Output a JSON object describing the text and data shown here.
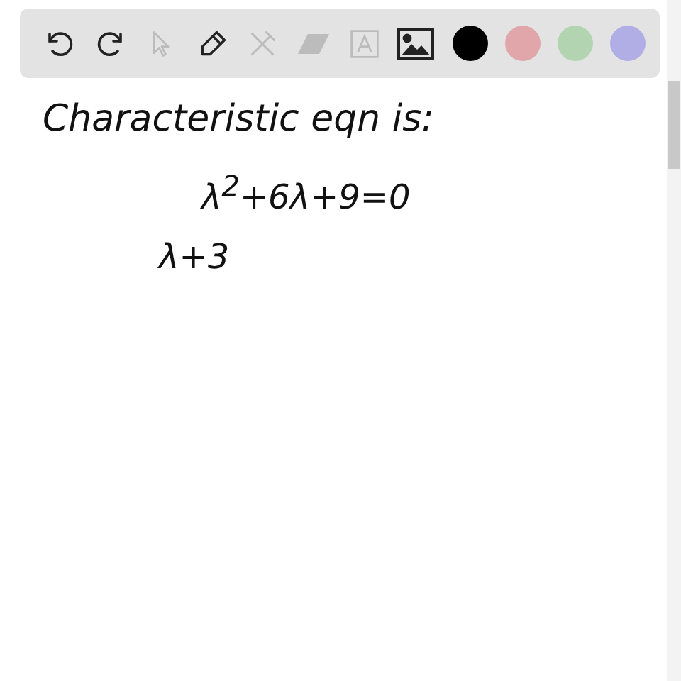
{
  "canvas": {
    "lines": [
      {
        "text": "Characteristic eqn is:",
        "kind": "heading"
      },
      {
        "text": "λ$^{2}$+6λ+9=0",
        "kind": "equation"
      },
      {
        "text": "λ+3",
        "kind": "step"
      }
    ]
  },
  "toolbar": {
    "tools": [
      {
        "kind": "undo",
        "disabled": false
      },
      {
        "kind": "redo",
        "disabled": false
      },
      {
        "kind": "select",
        "disabled": true
      },
      {
        "kind": "pen",
        "disabled": false
      },
      {
        "kind": "tools",
        "disabled": true
      },
      {
        "kind": "eraser",
        "disabled": true
      },
      {
        "kind": "text",
        "disabled": true
      },
      {
        "kind": "image",
        "disabled": false
      }
    ],
    "colors": [
      {
        "color": "#000000"
      },
      {
        "color": "#e0a6aa"
      },
      {
        "color": "#b2d4b0"
      },
      {
        "color": "#b0aee4"
      }
    ]
  }
}
